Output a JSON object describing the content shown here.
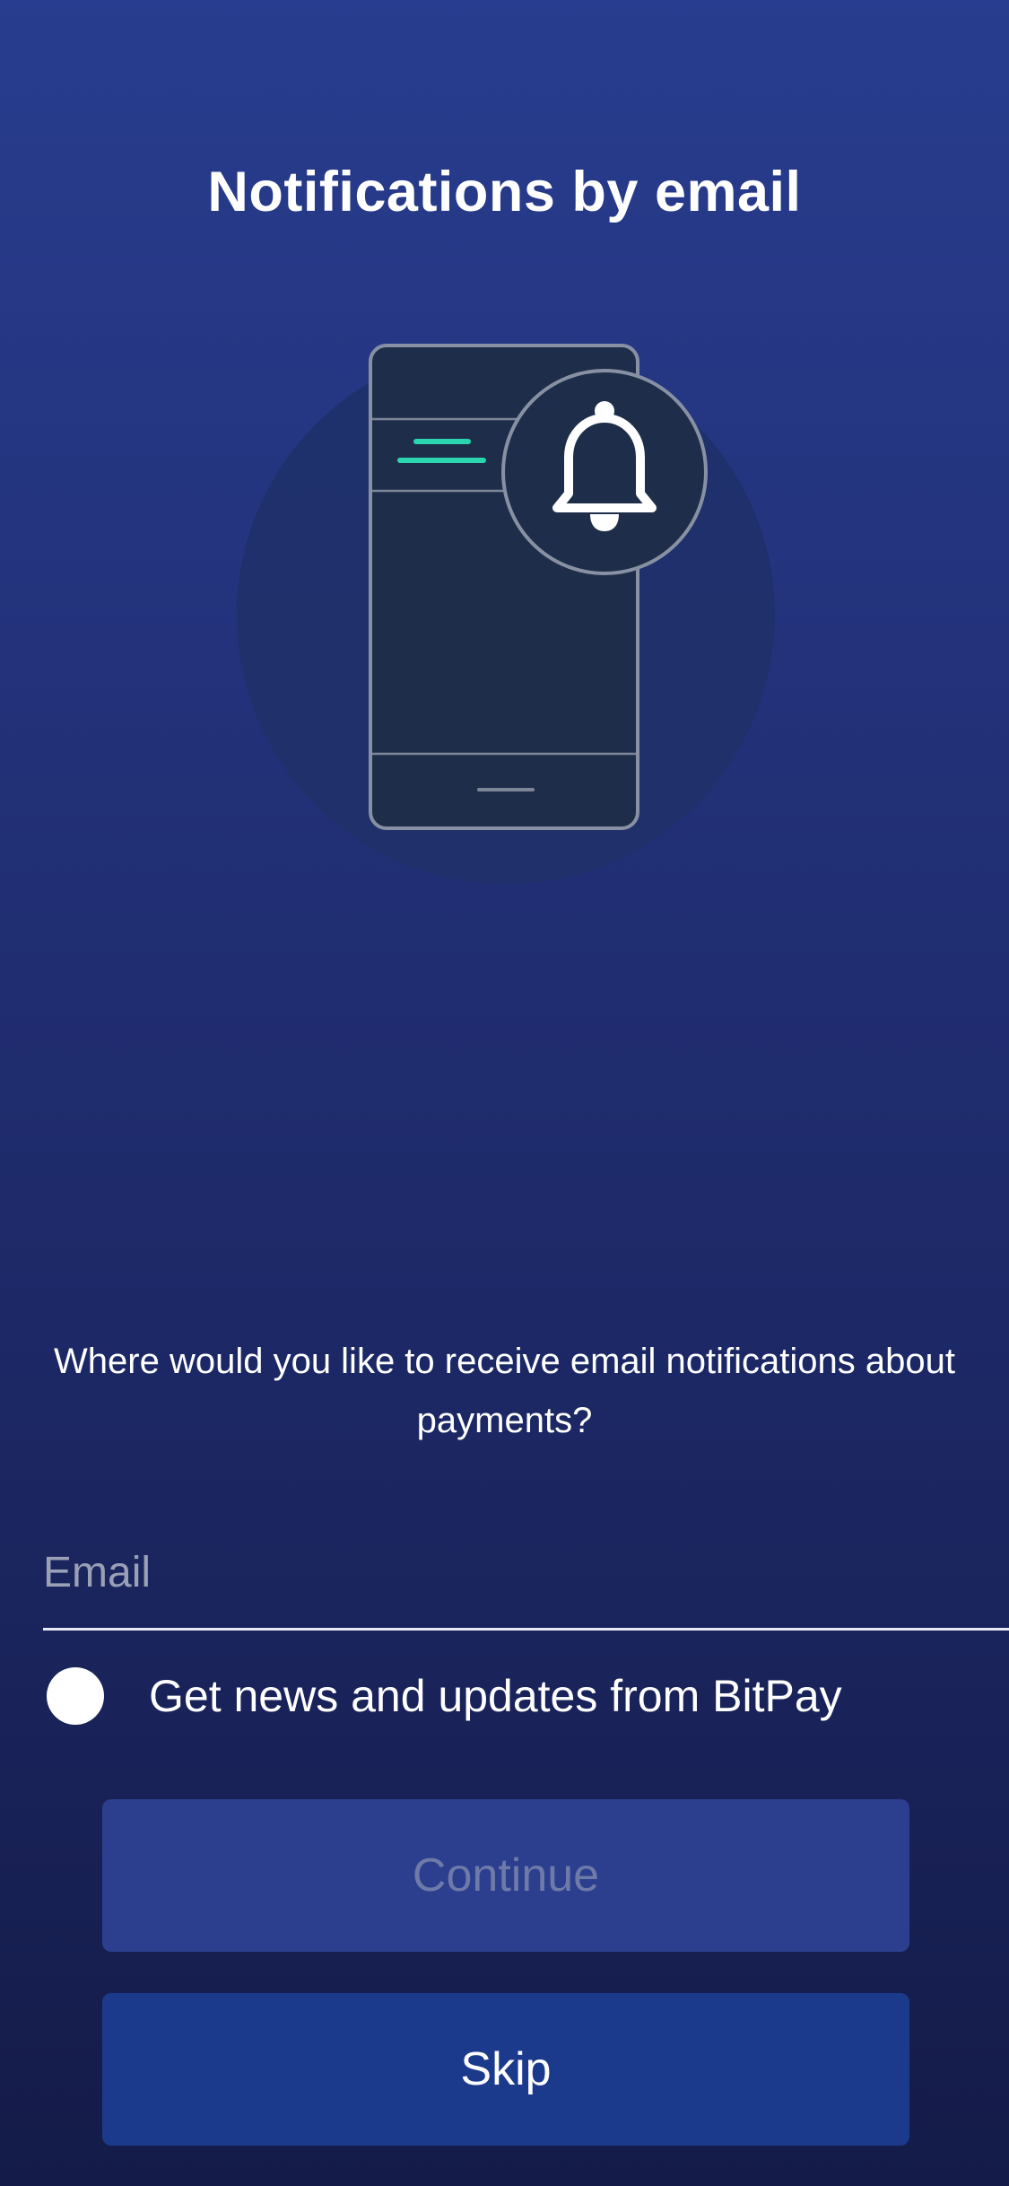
{
  "screen": {
    "title": "Notifications by email",
    "prompt": "Where would you like to receive email notifications about payments?"
  },
  "illustration": {
    "name": "phone-with-bell-illustration",
    "accent_color": "#2ad5b0"
  },
  "email_field": {
    "value": "",
    "placeholder": "Email"
  },
  "newsletter_checkbox": {
    "label": "Get news and updates from BitPay",
    "checked": false
  },
  "buttons": {
    "continue_label": "Continue",
    "continue_enabled": false,
    "skip_label": "Skip"
  },
  "colors": {
    "background_top": "#283d8f",
    "background_bottom": "#141b48",
    "continue_button_bg": "#2c3f8f",
    "skip_button_bg": "#1b3a8c"
  }
}
